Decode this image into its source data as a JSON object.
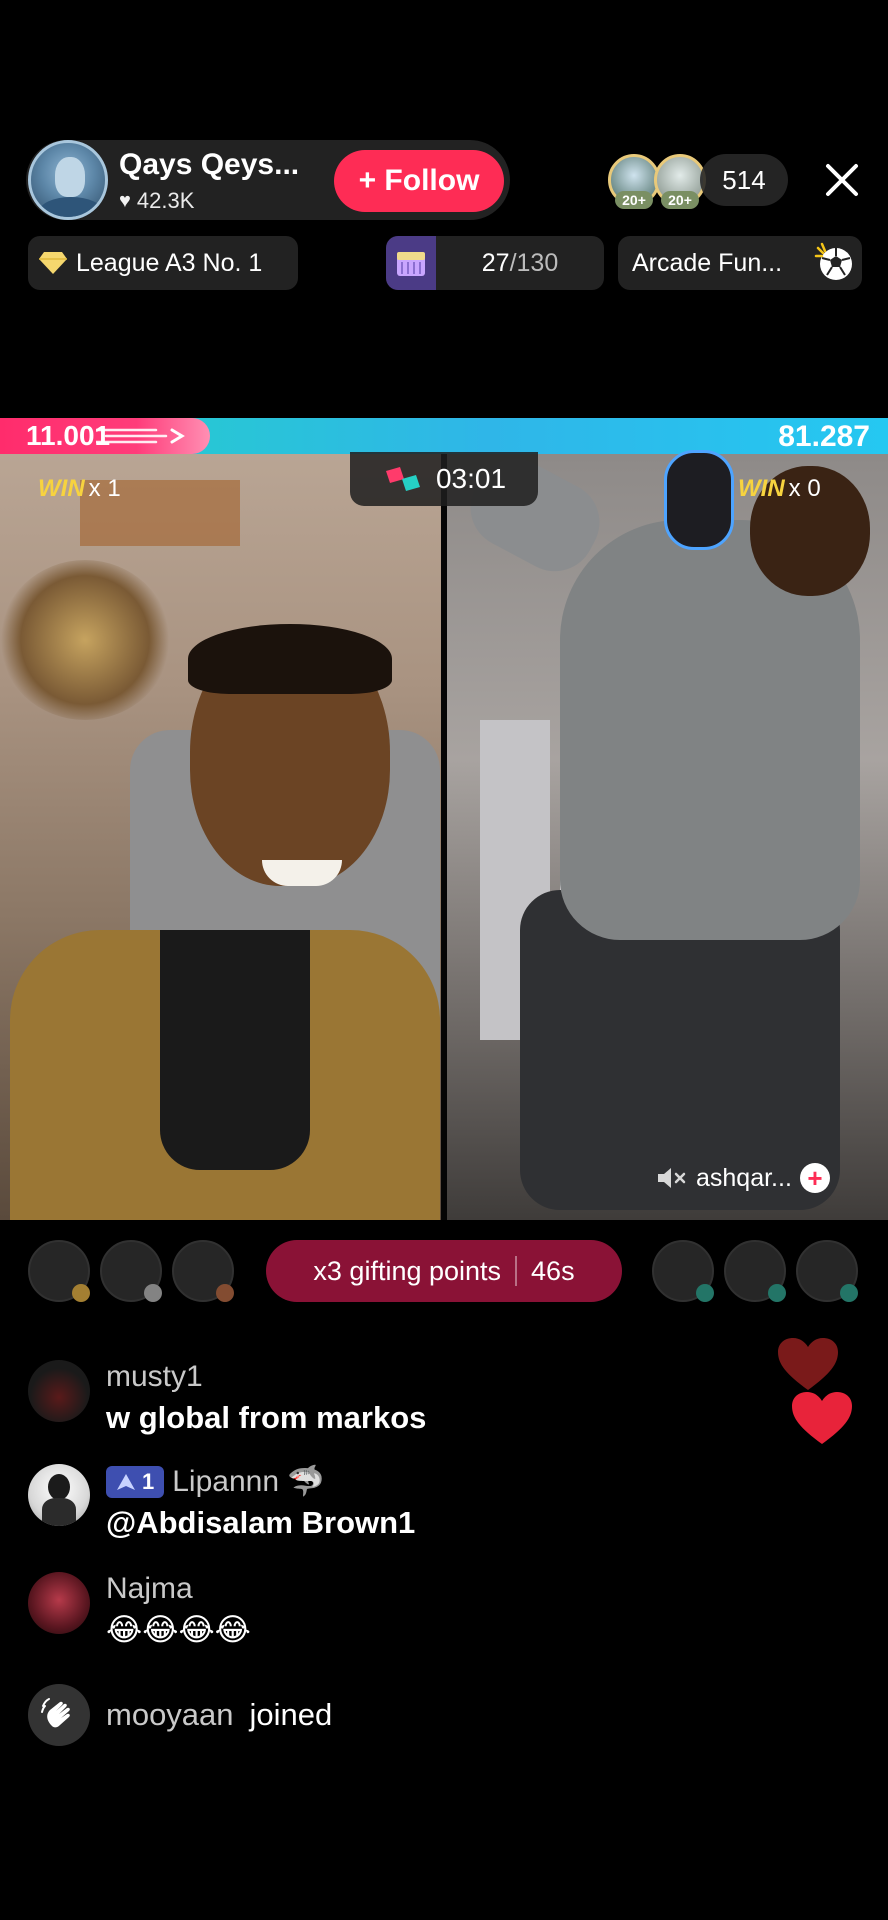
{
  "host": {
    "name": "Qays Qeys...",
    "likes": "42.3K",
    "follow_label": "+ Follow"
  },
  "viewers": {
    "badges": [
      "20+",
      "20+"
    ],
    "count": "514"
  },
  "badges": {
    "league": "League A3 No. 1",
    "goal_current": "27",
    "goal_total": "/130",
    "arcade": "Arcade Fun..."
  },
  "battle": {
    "left_score": "11.001",
    "right_score": "81.287",
    "timer": "03:01",
    "left_win_label": "WIN",
    "left_win_count": "x 1",
    "right_win_label": "WIN",
    "right_win_count": "x 0",
    "opponent_name": "ashqar...",
    "left_share": 0.119,
    "colors": {
      "left": "#ff2c6c",
      "right": "#2fb6e8"
    }
  },
  "gifting": {
    "label": "x3 gifting points",
    "countdown": "46s"
  },
  "chat": [
    {
      "user": "musty1",
      "message": "w global from markos"
    },
    {
      "user": "Lipannn 🦈",
      "rank": "1",
      "message": "@Abdisalam Brown1"
    },
    {
      "user": "Najma",
      "message": "😂😂😂😂"
    }
  ],
  "join": {
    "user": "mooyaan",
    "text": "joined"
  },
  "colors": {
    "accent": "#fe2c55",
    "win": "#f7d33f",
    "gifting_bg": "#8a1236"
  }
}
